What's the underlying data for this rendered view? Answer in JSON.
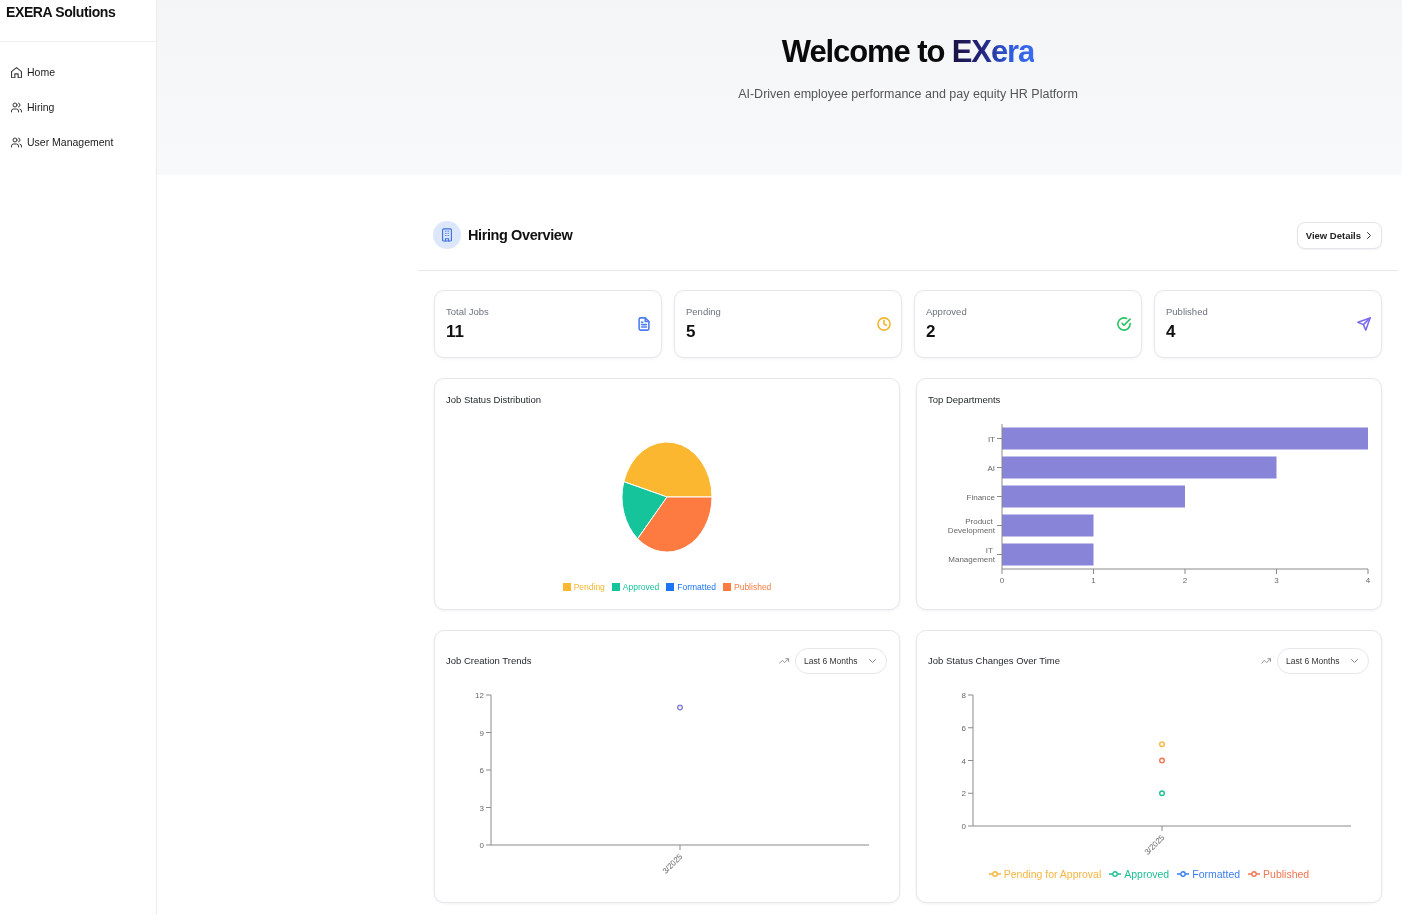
{
  "sidebar": {
    "brand": "EXERA Solutions",
    "items": [
      {
        "label": "Home",
        "kind": "home",
        "selected": false
      },
      {
        "label": "Hiring",
        "kind": "people",
        "selected": false
      },
      {
        "label": "User Management",
        "kind": "people",
        "selected": false
      }
    ]
  },
  "hero": {
    "title_lead": "Welcome to",
    "title_brand": "EXera",
    "subtitle": "AI-Driven employee performance and pay equity HR Platform"
  },
  "hiring_overview": {
    "title": "Hiring Overview",
    "action": "View Details",
    "stats": [
      {
        "label": "Total Jobs",
        "value": "11",
        "kind": "document",
        "color": "#4f7df3"
      },
      {
        "label": "Pending",
        "value": "5",
        "kind": "clock",
        "color": "#f2b52b"
      },
      {
        "label": "Approved",
        "value": "2",
        "kind": "check",
        "color": "#22c55e"
      },
      {
        "label": "Published",
        "value": "4",
        "kind": "send",
        "color": "#7c6cf0"
      }
    ],
    "charts": [
      {
        "title": "Job Status Distribution",
        "chart_data": {
          "type": "pie",
          "categories": [
            "Pending",
            "Approved",
            "Formatted",
            "Published"
          ],
          "values": [
            45.5,
            18.2,
            0,
            36.3
          ],
          "colors": [
            "#fbb72f",
            "#16c49b",
            "#1b74f5",
            "#fd7b40"
          ],
          "legend": "bottom"
        }
      },
      {
        "title": "Top Departments",
        "chart_data": {
          "type": "bar",
          "orientation": "horizontal",
          "categories": [
            "IT",
            "AI",
            "Finance",
            "Product Development",
            "IT Management"
          ],
          "series": [
            {
              "color": "#8884d8",
              "values": [
                4,
                3,
                2,
                1,
                1
              ]
            }
          ],
          "xlim": [
            0,
            4
          ],
          "xticks": [
            0,
            1,
            2,
            3,
            4
          ]
        }
      },
      {
        "title": "Job Creation Trends",
        "period": "Last 6 Months",
        "chart_data": {
          "type": "line",
          "categories": [
            "3/2025"
          ],
          "series": [
            {
              "color": "#8884d8",
              "marker": "circle",
              "values": [
                11
              ]
            }
          ],
          "ylim": [
            0,
            12
          ],
          "yticks": [
            0,
            3,
            6,
            9,
            12
          ]
        }
      },
      {
        "title": "Job Status Changes Over Time",
        "period": "Last 6 Months",
        "chart_data": {
          "type": "line",
          "categories": [
            "3/2025"
          ],
          "series": [
            {
              "name": "Pending for Approval",
              "color": "#f7b540",
              "marker": "circle",
              "values": [
                5
              ]
            },
            {
              "name": "Approved",
              "color": "#1fbf96",
              "marker": "circle",
              "values": [
                2
              ]
            },
            {
              "name": "Formatted",
              "color": "#3a7ef0",
              "marker": "circle",
              "values": [
                null
              ]
            },
            {
              "name": "Published",
              "color": "#f27552",
              "marker": "circle",
              "values": [
                4
              ]
            }
          ],
          "ylim": [
            0,
            8
          ],
          "yticks": [
            0,
            2,
            4,
            6,
            8
          ],
          "legend": "bottom"
        }
      }
    ]
  }
}
